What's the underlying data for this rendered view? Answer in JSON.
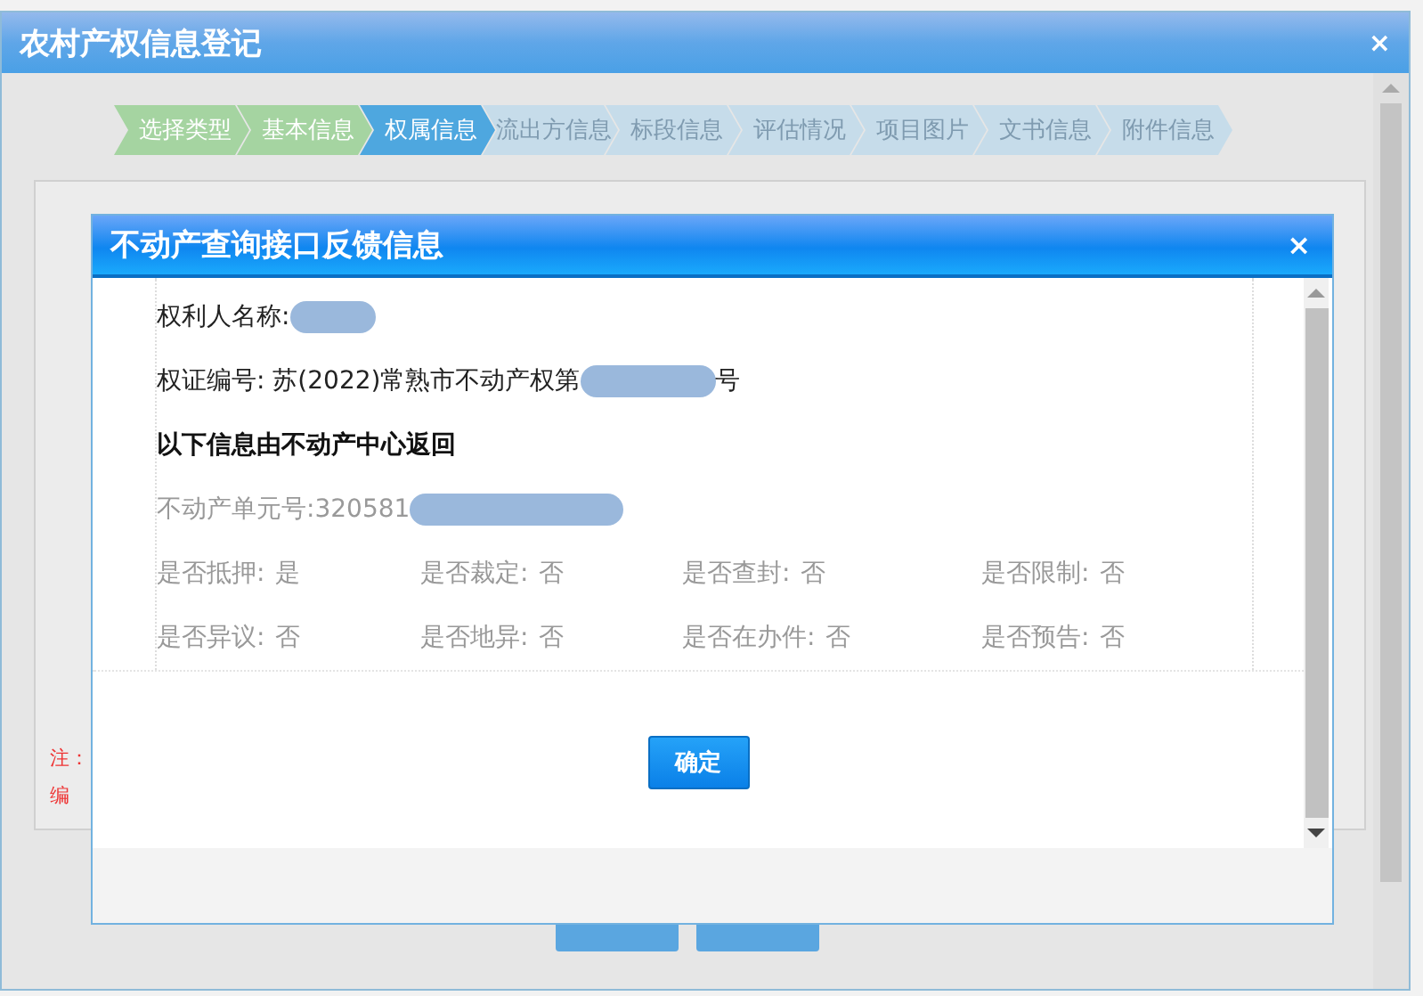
{
  "window": {
    "title": "农村产权信息登记",
    "close": "×"
  },
  "steps": [
    {
      "label": "选择类型",
      "completed": true,
      "selected": false
    },
    {
      "label": "基本信息",
      "completed": true,
      "selected": false
    },
    {
      "label": "权属信息",
      "completed": false,
      "selected": true
    },
    {
      "label": "流出方信息",
      "completed": false,
      "selected": false
    },
    {
      "label": "标段信息",
      "completed": false,
      "selected": false
    },
    {
      "label": "评估情况",
      "completed": false,
      "selected": false
    },
    {
      "label": "项目图片",
      "completed": false,
      "selected": false
    },
    {
      "label": "文书信息",
      "completed": false,
      "selected": false
    },
    {
      "label": "附件信息",
      "completed": false,
      "selected": false
    }
  ],
  "notes": [
    "注：",
    "编"
  ],
  "dialog": {
    "title": "不动产查询接口反馈信息",
    "close": "×",
    "lines": [
      {
        "kind": "field",
        "before": "权利人名称: ",
        "redacted": true
      },
      {
        "kind": "field",
        "before": "权证编号: 苏(2022)常熟市不动产权第",
        "redacted": true,
        "after": "号"
      },
      {
        "kind": "heading",
        "before": "以下信息由不动产中心返回",
        "redacted": false
      },
      {
        "kind": "muted",
        "before": "不动产单元号:320581",
        "redacted": true
      }
    ],
    "flags": [
      {
        "label": "是否抵押:",
        "value": "是"
      },
      {
        "label": "是否裁定:",
        "value": "否"
      },
      {
        "label": "是否查封:",
        "value": "否"
      },
      {
        "label": "是否限制:",
        "value": "否"
      },
      {
        "label": "是否异议:",
        "value": "否"
      },
      {
        "label": "是否地异:",
        "value": "否"
      },
      {
        "label": "是否在办件:",
        "value": "否"
      },
      {
        "label": "是否预告:",
        "value": "否"
      }
    ],
    "confirm": "确定"
  }
}
